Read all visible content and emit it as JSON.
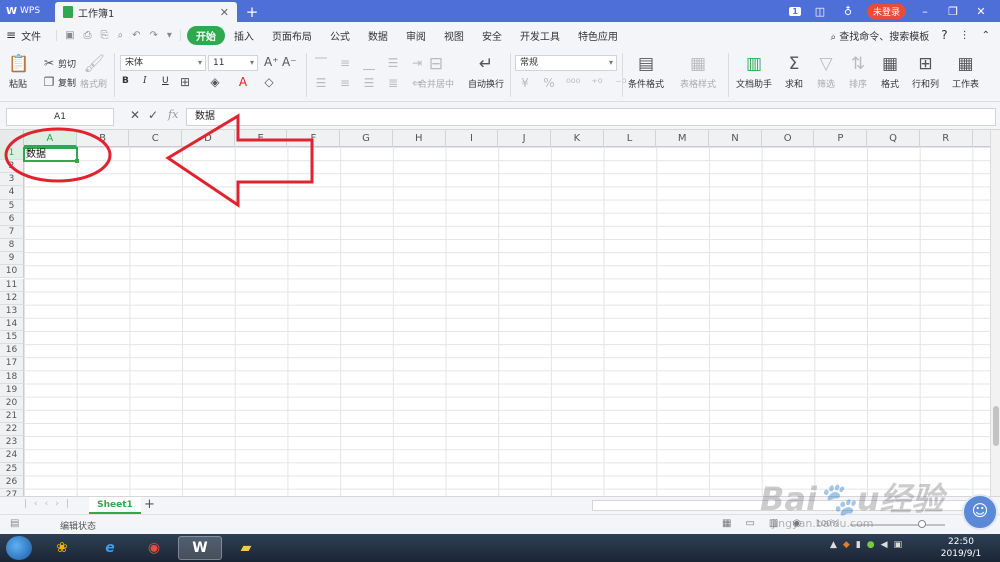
{
  "titlebar": {
    "wps_label": "WPS",
    "doc_tab_title": "工作簿1",
    "notification_count": "1",
    "login_label": "未登录"
  },
  "menu": {
    "items": [
      "文件",
      "开始",
      "插入",
      "页面布局",
      "公式",
      "数据",
      "审阅",
      "视图",
      "安全",
      "开发工具",
      "特色应用"
    ],
    "active": "开始",
    "search_label": "查找命令、搜索模板",
    "help_label": "?"
  },
  "ribbon": {
    "paste": "粘贴",
    "cut": "剪切",
    "copy": "复制",
    "format_painter": "格式刷",
    "font_name": "宋体",
    "font_size": "11",
    "bold": "B",
    "italic": "I",
    "underline": "U",
    "merge_center": "合并居中",
    "wrap_text": "自动换行",
    "number_format": "常规",
    "conditional_format": "条件格式",
    "table_style": "表格样式",
    "doc_assistant": "文档助手",
    "sum": "求和",
    "filter": "筛选",
    "sort": "排序",
    "format": "格式",
    "rows_cols": "行和列",
    "worksheet": "工作表"
  },
  "formula_bar": {
    "cell_ref": "A1",
    "fx_label": "fx",
    "content": "数据"
  },
  "grid": {
    "columns": [
      "A",
      "B",
      "C",
      "D",
      "E",
      "F",
      "G",
      "H",
      "I",
      "J",
      "K",
      "L",
      "M",
      "N",
      "O",
      "P",
      "Q",
      "R"
    ],
    "row_count": 27,
    "selected_column": "A",
    "selected_row": 1,
    "active_cell_value": "数据"
  },
  "sheets": {
    "tabs": [
      "Sheet1"
    ],
    "active": "Sheet1"
  },
  "status": {
    "mode": "编辑状态",
    "zoom": "100%"
  },
  "watermark": {
    "url": "jingyan.baidu.com"
  },
  "taskbar": {
    "time": "22:50",
    "date": "2019/9/1"
  },
  "colors": {
    "accent_green": "#2fa84f",
    "title_blue": "#4f6fd8",
    "annotation_red": "#e0232f"
  }
}
